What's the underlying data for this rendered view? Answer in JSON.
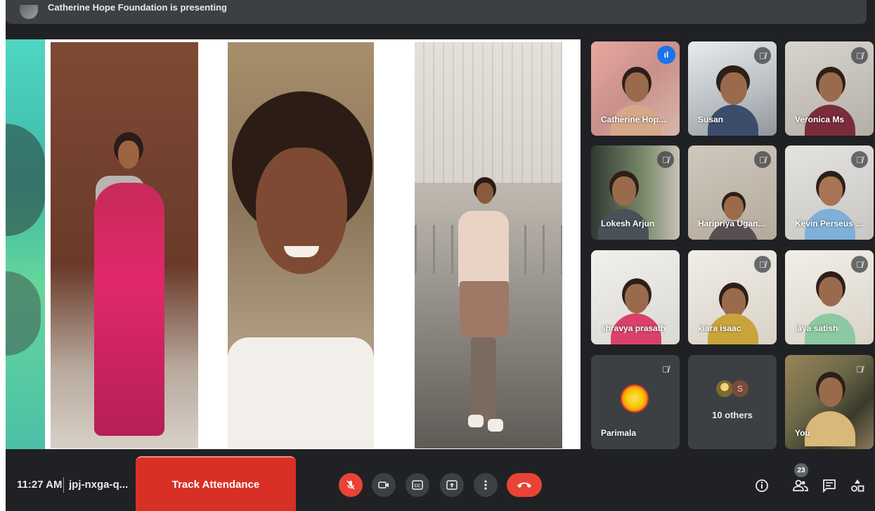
{
  "banner": {
    "presenter_text": "Catherine Hope Foundation is presenting"
  },
  "participants": [
    {
      "name": "Catherine Hop...",
      "status": "speaking"
    },
    {
      "name": "Susan",
      "status": "muted"
    },
    {
      "name": "Veronica Ms",
      "status": "muted"
    },
    {
      "name": "Lokesh Arjun",
      "status": "muted"
    },
    {
      "name": "Haripriya Ugan...",
      "status": "muted"
    },
    {
      "name": "Kevin Perseus ...",
      "status": "muted"
    },
    {
      "name": "shravya prasath",
      "status": "video"
    },
    {
      "name": "kiara isaac",
      "status": "muted"
    },
    {
      "name": "laya satish",
      "status": "muted"
    },
    {
      "name": "Parimala",
      "status": "muted"
    },
    {
      "name": "You",
      "status": "muted"
    }
  ],
  "others": {
    "count_label": "10 others",
    "avatar_letter": "S"
  },
  "bottom_bar": {
    "time": "11:27 AM",
    "meeting_code": "jpj-nxga-q...",
    "track_attendance_label": "Track Attendance",
    "people_count": "23"
  },
  "icons": {
    "mic_off": "mic-off-icon",
    "camera": "camera-icon",
    "captions": "captions-icon",
    "present": "present-icon",
    "more": "more-vert-icon",
    "hang_up": "call-end-icon",
    "info": "info-icon",
    "people": "people-icon",
    "chat": "chat-icon",
    "activities": "activities-icon"
  },
  "colors": {
    "background": "#202124",
    "tile": "#3c4043",
    "red": "#ea4335",
    "track": "#d93025",
    "active_outline": "#8ab4f8"
  }
}
